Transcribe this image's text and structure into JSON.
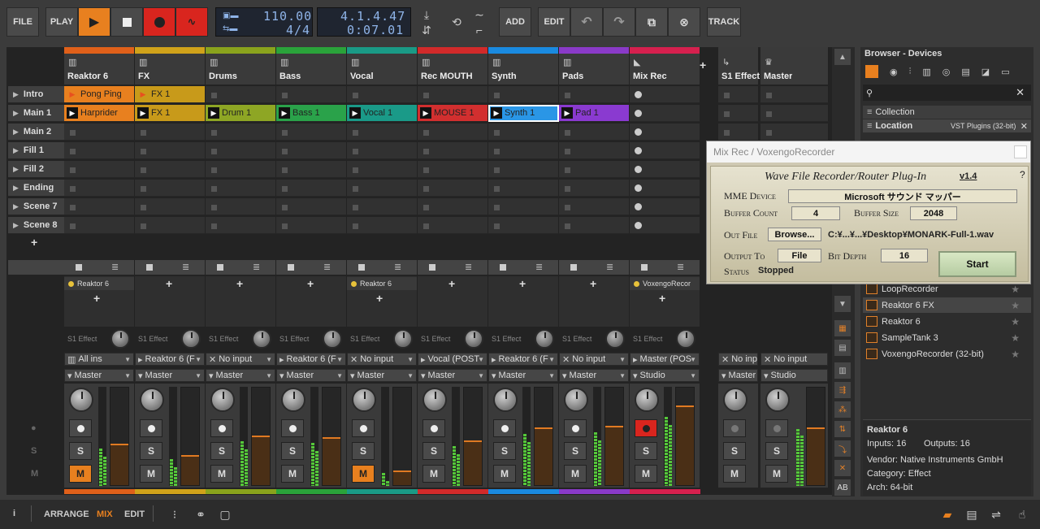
{
  "toolbar": {
    "file": "FILE",
    "play": "PLAY",
    "add": "ADD",
    "edit": "EDIT",
    "track": "TRACK",
    "tempo": "110.00",
    "signature": "4/4",
    "position": "4.1.4.47",
    "time": "0:07.01"
  },
  "colors": {
    "accent": "#e8801f",
    "record": "#d9251e",
    "lcd_text": "#8fb4e8"
  },
  "scenes": [
    "Intro",
    "Main 1",
    "Main 2",
    "Fill 1",
    "Fill 2",
    "Ending",
    "Scene 7",
    "Scene 8"
  ],
  "tracks": [
    {
      "name": "Reaktor 6",
      "color": "#e0601a",
      "device": "Reaktor 6",
      "input": "All ins",
      "output": "Master",
      "send": "S1 Effect",
      "clips": {
        "0": "Pong Ping",
        "1": "Harprider"
      },
      "clipColor": "#e8801f",
      "mute": true,
      "level": 0.42
    },
    {
      "name": "FX",
      "color": "#d0a21a",
      "device": "",
      "input": "Reaktor 6 (F",
      "output": "Master",
      "send": "S1 Effect",
      "clips": {
        "0": "FX 1",
        "1": "FX 1"
      },
      "clipColor": "#c89a1a",
      "mute": false,
      "level": 0.3
    },
    {
      "name": "Drums",
      "color": "#8aa31c",
      "device": "",
      "input": "No input",
      "output": "Master",
      "send": "S1 Effect",
      "clips": {
        "1": "Drum 1"
      },
      "clipColor": "#8ea624",
      "mute": false,
      "level": 0.5
    },
    {
      "name": "Bass",
      "color": "#2aa33a",
      "device": "",
      "input": "Reaktor 6 (F",
      "output": "Master",
      "send": "S1 Effect",
      "clips": {
        "1": "Bass 1"
      },
      "clipColor": "#2aa24a",
      "mute": false,
      "level": 0.48
    },
    {
      "name": "Vocal",
      "color": "#1a9a86",
      "device": "Reaktor 6",
      "input": "No input",
      "output": "Master",
      "send": "S1 Effect",
      "clips": {
        "1": "Vocal 1"
      },
      "clipColor": "#1a9a88",
      "mute": true,
      "level": 0.15
    },
    {
      "name": "Rec MOUTH",
      "color": "#d22a2a",
      "device": "",
      "input": "Vocal (POST",
      "output": "Master",
      "send": "S1 Effect",
      "clips": {
        "1": "MOUSE 1"
      },
      "clipColor": "#d22f2f",
      "mute": false,
      "level": 0.45
    },
    {
      "name": "Synth",
      "color": "#1a8ae0",
      "device": "",
      "input": "Reaktor 6 (F",
      "output": "Master",
      "send": "S1 Effect",
      "clips": {
        "1": "Synth 1"
      },
      "clipColor": "#2a96e6",
      "mute": false,
      "level": 0.58
    },
    {
      "name": "Pads",
      "color": "#8a3ac8",
      "device": "",
      "input": "No input",
      "output": "Master",
      "send": "S1 Effect",
      "clips": {
        "1": "Pad 1"
      },
      "clipColor": "#8a3ad0",
      "mute": false,
      "level": 0.6
    },
    {
      "name": "Mix Rec",
      "color": "#d6204e",
      "device": "VoxengoRecor",
      "input": "Master (POS",
      "output": "Studio",
      "send": "S1 Effect",
      "clips": {},
      "clipColor": "#888",
      "mute": false,
      "level": 0.8,
      "armed": true
    }
  ],
  "fx_tracks": [
    {
      "name": "S1 Effect",
      "input": "No inp",
      "output": "Master",
      "level": 0.0
    },
    {
      "name": "Master",
      "input": "No input",
      "output": "Studio",
      "level": 0.58
    }
  ],
  "side_labels": {
    "mute": "M",
    "solo": "S",
    "arm": "●"
  },
  "popup": {
    "title": "Mix Rec / VoxengoRecorder",
    "heading": "Wave File Recorder/Router Plug-In",
    "version": "v1.4",
    "help": "?",
    "mme_label": "MME Device",
    "mme_value": "Microsoft サウンド マッパー",
    "buffer_count_label": "Buffer Count",
    "buffer_count": "4",
    "buffer_size_label": "Buffer Size",
    "buffer_size": "2048",
    "out_file_label": "Out File",
    "browse": "Browse...",
    "out_file": "C:¥...¥...¥Desktop¥MONARK-Full-1.wav",
    "output_to_label": "Output To",
    "output_to": "File",
    "bit_depth_label": "Bit Depth",
    "bit_depth": "16",
    "status_label": "Status",
    "status": "Stopped",
    "start": "Start"
  },
  "browser": {
    "title": "Browser - Devices",
    "collection": "Collection",
    "location": "Location",
    "location_value": "VST Plugins (32-bit)",
    "items": [
      "LoopRecorder",
      "Reaktor 6 FX",
      "Reaktor 6",
      "SampleTank 3",
      "VoxengoRecorder (32-bit)"
    ],
    "info": {
      "name": "Reaktor 6",
      "inputs": "Inputs: 16",
      "outputs": "Outputs: 16",
      "vendor": "Vendor: Native Instruments GmbH",
      "category": "Category: Effect",
      "arch": "Arch: 64-bit"
    }
  },
  "footer": {
    "info": "i",
    "arrange": "ARRANGE",
    "mix": "MIX",
    "edit": "EDIT"
  }
}
